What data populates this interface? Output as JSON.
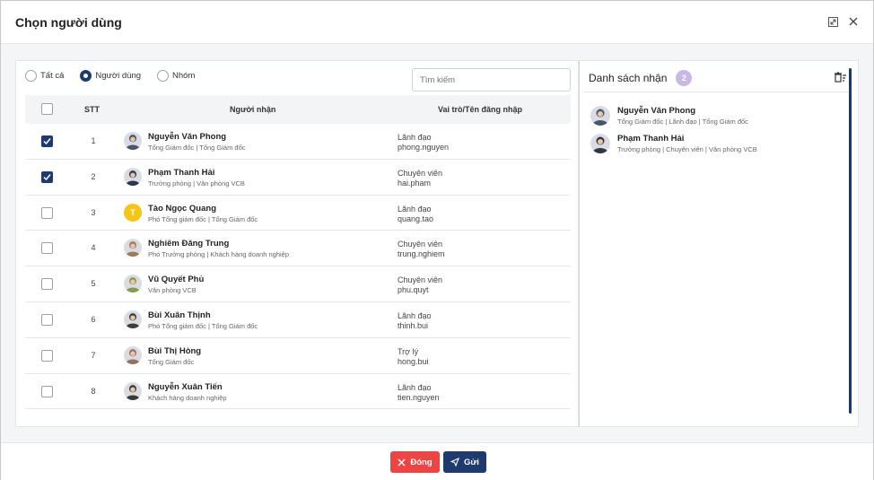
{
  "dialog": {
    "title": "Chọn người dùng"
  },
  "filters": {
    "options": [
      {
        "label": "Tất cả",
        "selected": false
      },
      {
        "label": "Người dùng",
        "selected": true
      },
      {
        "label": "Nhóm",
        "selected": false
      }
    ],
    "search_placeholder": "Tìm kiếm"
  },
  "table": {
    "headers": {
      "stt": "STT",
      "recipient": "Người nhận",
      "role": "Vai trò/Tên đăng nhập"
    },
    "rows": [
      {
        "checked": true,
        "stt": "1",
        "name": "Nguyễn Văn Phong",
        "sub": "Tổng Giám đốc | Tổng Giám đốc",
        "role": "Lãnh đạo",
        "username": "phong.nguyen",
        "avatar": "photo"
      },
      {
        "checked": true,
        "stt": "2",
        "name": "Phạm Thanh Hải",
        "sub": "Trưởng phòng | Văn phòng VCB",
        "role": "Chuyên viên",
        "username": "hai.pham",
        "avatar": "photo"
      },
      {
        "checked": false,
        "stt": "3",
        "name": "Tào Ngọc Quang",
        "sub": "Phó Tổng giám đốc | Tổng Giám đốc",
        "role": "Lãnh đạo",
        "username": "quang.tao",
        "avatar": "T"
      },
      {
        "checked": false,
        "stt": "4",
        "name": "Nghiêm Đăng Trung",
        "sub": "Phó Trưởng phòng | Khách hàng doanh nghiệp",
        "role": "Chuyên viên",
        "username": "trung.nghiem",
        "avatar": "photo"
      },
      {
        "checked": false,
        "stt": "5",
        "name": "Vũ Quyết Phủ",
        "sub": "Văn phòng VCB",
        "role": "Chuyên viên",
        "username": "phu.quyt",
        "avatar": "photo"
      },
      {
        "checked": false,
        "stt": "6",
        "name": "Bùi Xuân Thịnh",
        "sub": "Phó Tổng giám đốc | Tổng Giám đốc",
        "role": "Lãnh đạo",
        "username": "thinh.bui",
        "avatar": "photo"
      },
      {
        "checked": false,
        "stt": "7",
        "name": "Bùi Thị Hòng",
        "sub": "Tổng Giám đốc",
        "role": "Trợ lý",
        "username": "hong.bui",
        "avatar": "photo"
      },
      {
        "checked": false,
        "stt": "8",
        "name": "Nguyễn Xuân Tiến",
        "sub": "Khách hàng doanh nghiệp",
        "role": "Lãnh đạo",
        "username": "tien.nguyen",
        "avatar": "photo"
      }
    ]
  },
  "recipients": {
    "title": "Danh sách nhận",
    "count": "2",
    "items": [
      {
        "name": "Nguyễn Văn Phong",
        "sub": "Tổng Giám đốc | Lãnh đạo | Tổng Giám đốc"
      },
      {
        "name": "Phạm Thanh Hải",
        "sub": "Trưởng phòng | Chuyên viên | Văn phòng VCB"
      }
    ]
  },
  "footer": {
    "close_label": "Đóng",
    "send_label": "Gửi"
  },
  "colors": {
    "primary": "#1e3a6e",
    "danger": "#ef4444",
    "badge": "#c9b8e6",
    "avatar_letter_bg": "#f5c518"
  }
}
